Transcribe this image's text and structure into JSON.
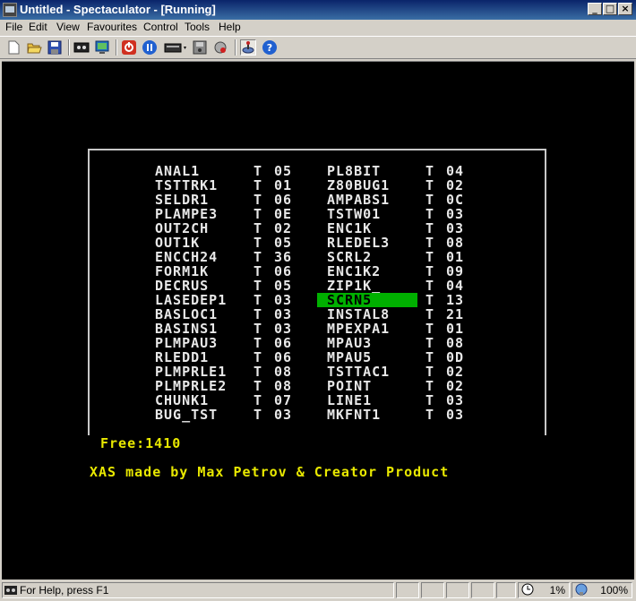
{
  "window": {
    "title": "Untitled - Spectaculator - [Running]"
  },
  "menu": [
    "File",
    "Edit",
    "View",
    "Favourites",
    "Control",
    "Tools",
    "Help"
  ],
  "toolbar": {
    "buttons": [
      "new-file-icon",
      "open-folder-icon",
      "save-disk-icon",
      "tape-icon",
      "monitor-icon",
      "power-icon",
      "pause-icon",
      "keyboard-icon",
      "disk-icon",
      "virus-icon",
      "joystick-icon",
      "help-icon"
    ]
  },
  "catalog": {
    "left": [
      {
        "name": "ANAL1",
        "type": "T",
        "num": "05"
      },
      {
        "name": "TSTTRK1",
        "type": "T",
        "num": "01"
      },
      {
        "name": "SELDR1",
        "type": "T",
        "num": "06"
      },
      {
        "name": "PLAMPE3",
        "type": "T",
        "num": "0E"
      },
      {
        "name": "OUT2CH",
        "type": "T",
        "num": "02"
      },
      {
        "name": "OUT1K",
        "type": "T",
        "num": "05"
      },
      {
        "name": "ENCCH24",
        "type": "T",
        "num": "36"
      },
      {
        "name": "FORM1K",
        "type": "T",
        "num": "06"
      },
      {
        "name": "DECRUS",
        "type": "T",
        "num": "05"
      },
      {
        "name": "LASEDEP1",
        "type": "T",
        "num": "03"
      },
      {
        "name": "BASLOC1",
        "type": "T",
        "num": "03"
      },
      {
        "name": "BASINS1",
        "type": "T",
        "num": "03"
      },
      {
        "name": "PLMPAU3",
        "type": "T",
        "num": "06"
      },
      {
        "name": "RLEDD1",
        "type": "T",
        "num": "06"
      },
      {
        "name": "PLMPRLE1",
        "type": "T",
        "num": "08"
      },
      {
        "name": "PLMPRLE2",
        "type": "T",
        "num": "08"
      },
      {
        "name": "CHUNK1",
        "type": "T",
        "num": "07"
      },
      {
        "name": "BUG_TST",
        "type": "T",
        "num": "03"
      }
    ],
    "right": [
      {
        "name": "PL8BIT",
        "type": "T",
        "num": "04"
      },
      {
        "name": "Z80BUG1",
        "type": "T",
        "num": "02"
      },
      {
        "name": "AMPABS1",
        "type": "T",
        "num": "0C"
      },
      {
        "name": "TSTW01",
        "type": "T",
        "num": "03"
      },
      {
        "name": "ENC1K",
        "type": "T",
        "num": "03"
      },
      {
        "name": "RLEDEL3",
        "type": "T",
        "num": "08"
      },
      {
        "name": "SCRL2",
        "type": "T",
        "num": "01"
      },
      {
        "name": "ENC1K2",
        "type": "T",
        "num": "09"
      },
      {
        "name": "ZIP1K_",
        "type": "T",
        "num": "04"
      },
      {
        "name": "SCRN5",
        "type": "T",
        "num": "13"
      },
      {
        "name": "INSTAL8",
        "type": "T",
        "num": "21"
      },
      {
        "name": "MPEXPA1",
        "type": "T",
        "num": "01"
      },
      {
        "name": "MPAU3",
        "type": "T",
        "num": "08"
      },
      {
        "name": "MPAU5",
        "type": "T",
        "num": "0D"
      },
      {
        "name": "TSTTAC1",
        "type": "T",
        "num": "02"
      },
      {
        "name": "POINT",
        "type": "T",
        "num": "02"
      },
      {
        "name": "LINE1",
        "type": "T",
        "num": "03"
      },
      {
        "name": "MKFNT1",
        "type": "T",
        "num": "03"
      }
    ],
    "selected_index_right": 9,
    "free": "Free:1410",
    "credit": "XAS made by Max Petrov & Creator Product"
  },
  "colors": {
    "screen_bg": "#000000",
    "text": "#e8e8e8",
    "accent": "#e8e800",
    "selection": "#00b000"
  },
  "status": {
    "help": "For Help, press F1",
    "cpu": "1%",
    "speed": "100%"
  }
}
